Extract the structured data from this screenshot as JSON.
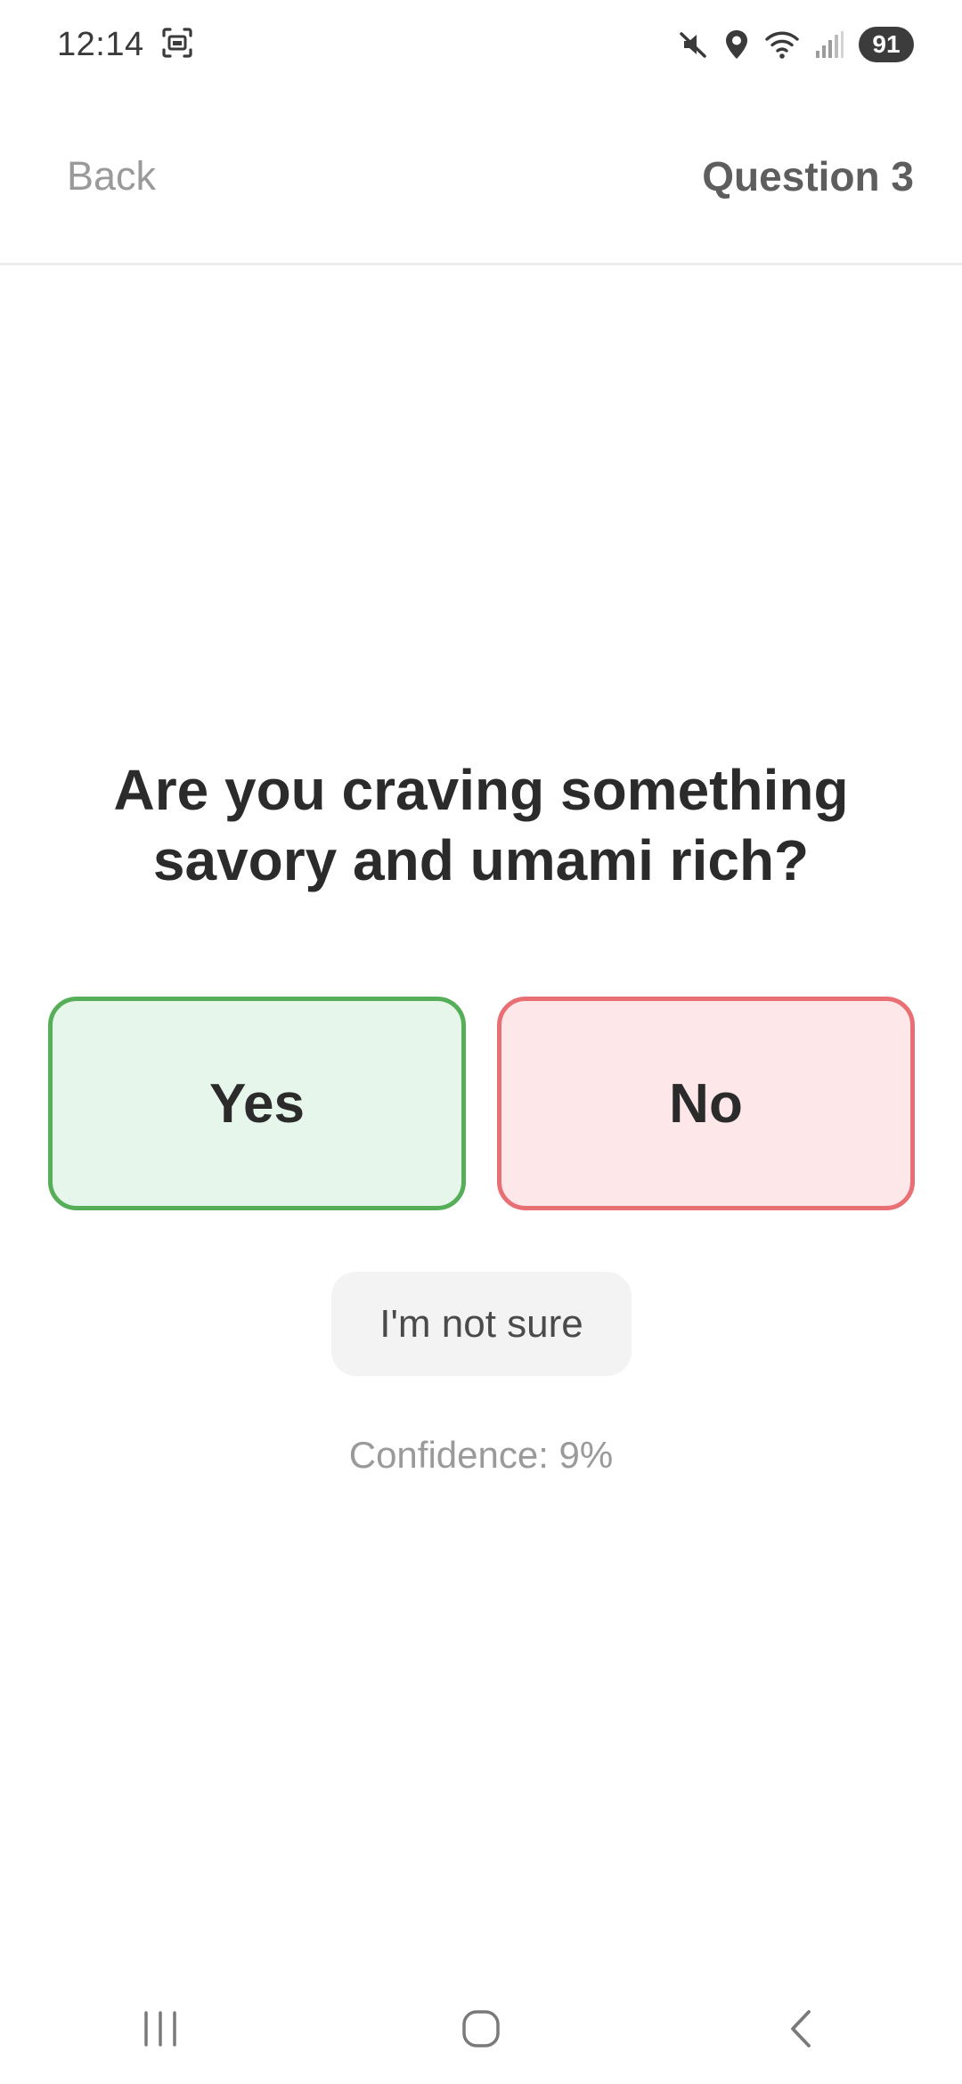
{
  "status_bar": {
    "time": "12:14",
    "battery": "91",
    "icons": [
      "screenshot-icon",
      "mute-icon",
      "location-icon",
      "wifi-icon",
      "signal-icon"
    ]
  },
  "header": {
    "back_label": "Back",
    "question_label": "Question 3"
  },
  "question": {
    "text": "Are you craving something savory and umami rich?"
  },
  "answers": {
    "yes_label": "Yes",
    "no_label": "No",
    "not_sure_label": "I'm not sure"
  },
  "confidence_text": "Confidence: 9%",
  "nav": {
    "icons": [
      "recents-icon",
      "home-icon",
      "back-icon"
    ]
  },
  "colors": {
    "yes_bg": "#e6f6ea",
    "yes_border": "#56ae58",
    "no_bg": "#fde7e9",
    "no_border": "#e86f73",
    "text_primary": "#2b2b2b",
    "text_muted": "#9a9a9a"
  }
}
